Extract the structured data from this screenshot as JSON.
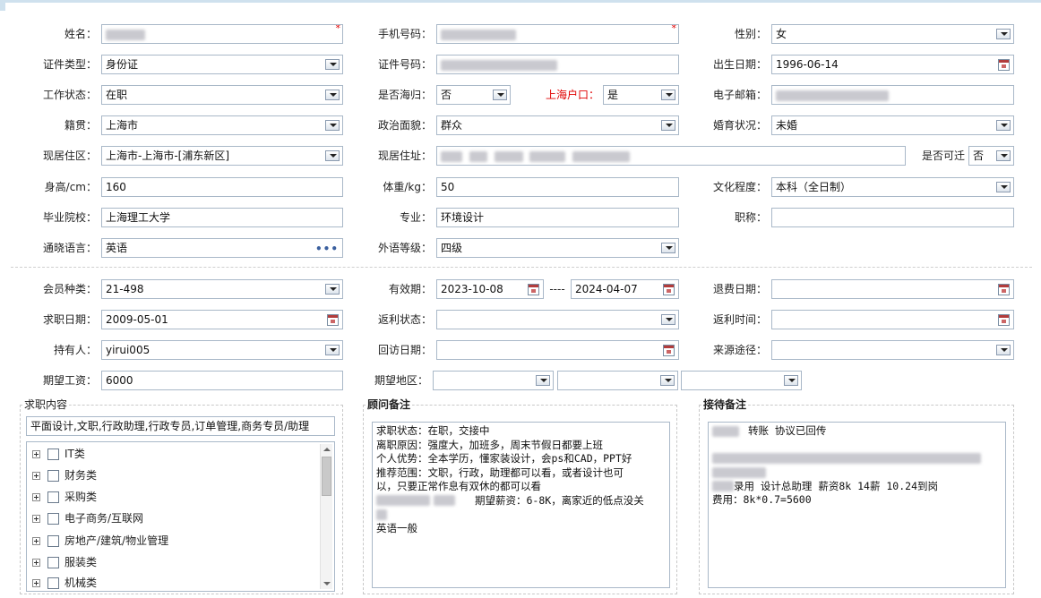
{
  "form": {
    "name": {
      "label": "姓名：",
      "value": ""
    },
    "phone": {
      "label": "手机号码：",
      "value": ""
    },
    "gender": {
      "label": "性别：",
      "value": "女"
    },
    "id_type": {
      "label": "证件类型：",
      "value": "身份证"
    },
    "id_no": {
      "label": "证件号码：",
      "value": ""
    },
    "birth": {
      "label": "出生日期：",
      "value": "1996-06-14"
    },
    "work_status": {
      "label": "工作状态：",
      "value": "在职"
    },
    "returnee": {
      "label": "是否海归：",
      "value": "否"
    },
    "sh_hukou": {
      "label": "上海户口：",
      "value": "是"
    },
    "email": {
      "label": "电子邮箱：",
      "value": ""
    },
    "native": {
      "label": "籍贯：",
      "value": "上海市"
    },
    "political": {
      "label": "政治面貌：",
      "value": "群众"
    },
    "marital": {
      "label": "婚育状况：",
      "value": "未婚"
    },
    "region": {
      "label": "现居住区：",
      "value": "上海市-上海市-[浦东新区]"
    },
    "address": {
      "label": "现居住址：",
      "value": ""
    },
    "relocate": {
      "label": "是否可迁",
      "value": "否"
    },
    "height": {
      "label": "身高/cm：",
      "value": "160"
    },
    "weight": {
      "label": "体重/kg：",
      "value": "50"
    },
    "education": {
      "label": "文化程度：",
      "value": "本科（全日制）"
    },
    "school": {
      "label": "毕业院校：",
      "value": "上海理工大学"
    },
    "major": {
      "label": "专业：",
      "value": "环境设计"
    },
    "title": {
      "label": "职称：",
      "value": ""
    },
    "language": {
      "label": "通晓语言：",
      "value": "英语",
      "picker": "•••"
    },
    "lang_level": {
      "label": "外语等级：",
      "value": "四级"
    }
  },
  "member": {
    "type": {
      "label": "会员种类：",
      "value": "21-498"
    },
    "valid": {
      "label": "有效期：",
      "from": "2023-10-08",
      "sep": "----",
      "to": "2024-04-07"
    },
    "refund_date": {
      "label": "退费日期：",
      "value": ""
    },
    "job_date": {
      "label": "求职日期：",
      "value": "2009-05-01"
    },
    "rebate_status": {
      "label": "返利状态：",
      "value": ""
    },
    "rebate_time": {
      "label": "返利时间：",
      "value": ""
    },
    "holder": {
      "label": "持有人：",
      "value": "yirui005"
    },
    "visit_date": {
      "label": "回访日期：",
      "value": ""
    },
    "source": {
      "label": "来源途径：",
      "value": ""
    },
    "salary": {
      "label": "期望工资：",
      "value": "6000"
    },
    "area": {
      "label": "期望地区：",
      "v1": "",
      "v2": "",
      "v3": ""
    }
  },
  "job_content": {
    "title": "求职内容",
    "summary": "平面设计,文职,行政助理,行政专员,订单管理,商务专员/助理",
    "tree": [
      "IT类",
      "财务类",
      "采购类",
      "电子商务/互联网",
      "房地产/建筑/物业管理",
      "服装类",
      "机械类"
    ]
  },
  "consultant": {
    "title": "顾问备注",
    "lines": [
      "求职状态：在职，交接中",
      "离职原因：强度大，加班多，周末节假日都要上班",
      "个人优势：全本学历，懂家装设计，会ps和CAD，PPT好",
      "推荐范围：文职，行政，助理都可以看，或者设计也可",
      "以，只要正常作息有双休的都可以看",
      "期望薪资：6-8K，离家近的低点没关",
      "",
      "英语一般"
    ]
  },
  "reception": {
    "title": "接待备注",
    "lines": [
      "转账 协议已回传",
      "录用 设计总助理 薪资8k 14薪 10.24到岗",
      "费用：8k*0.7=5600"
    ]
  }
}
